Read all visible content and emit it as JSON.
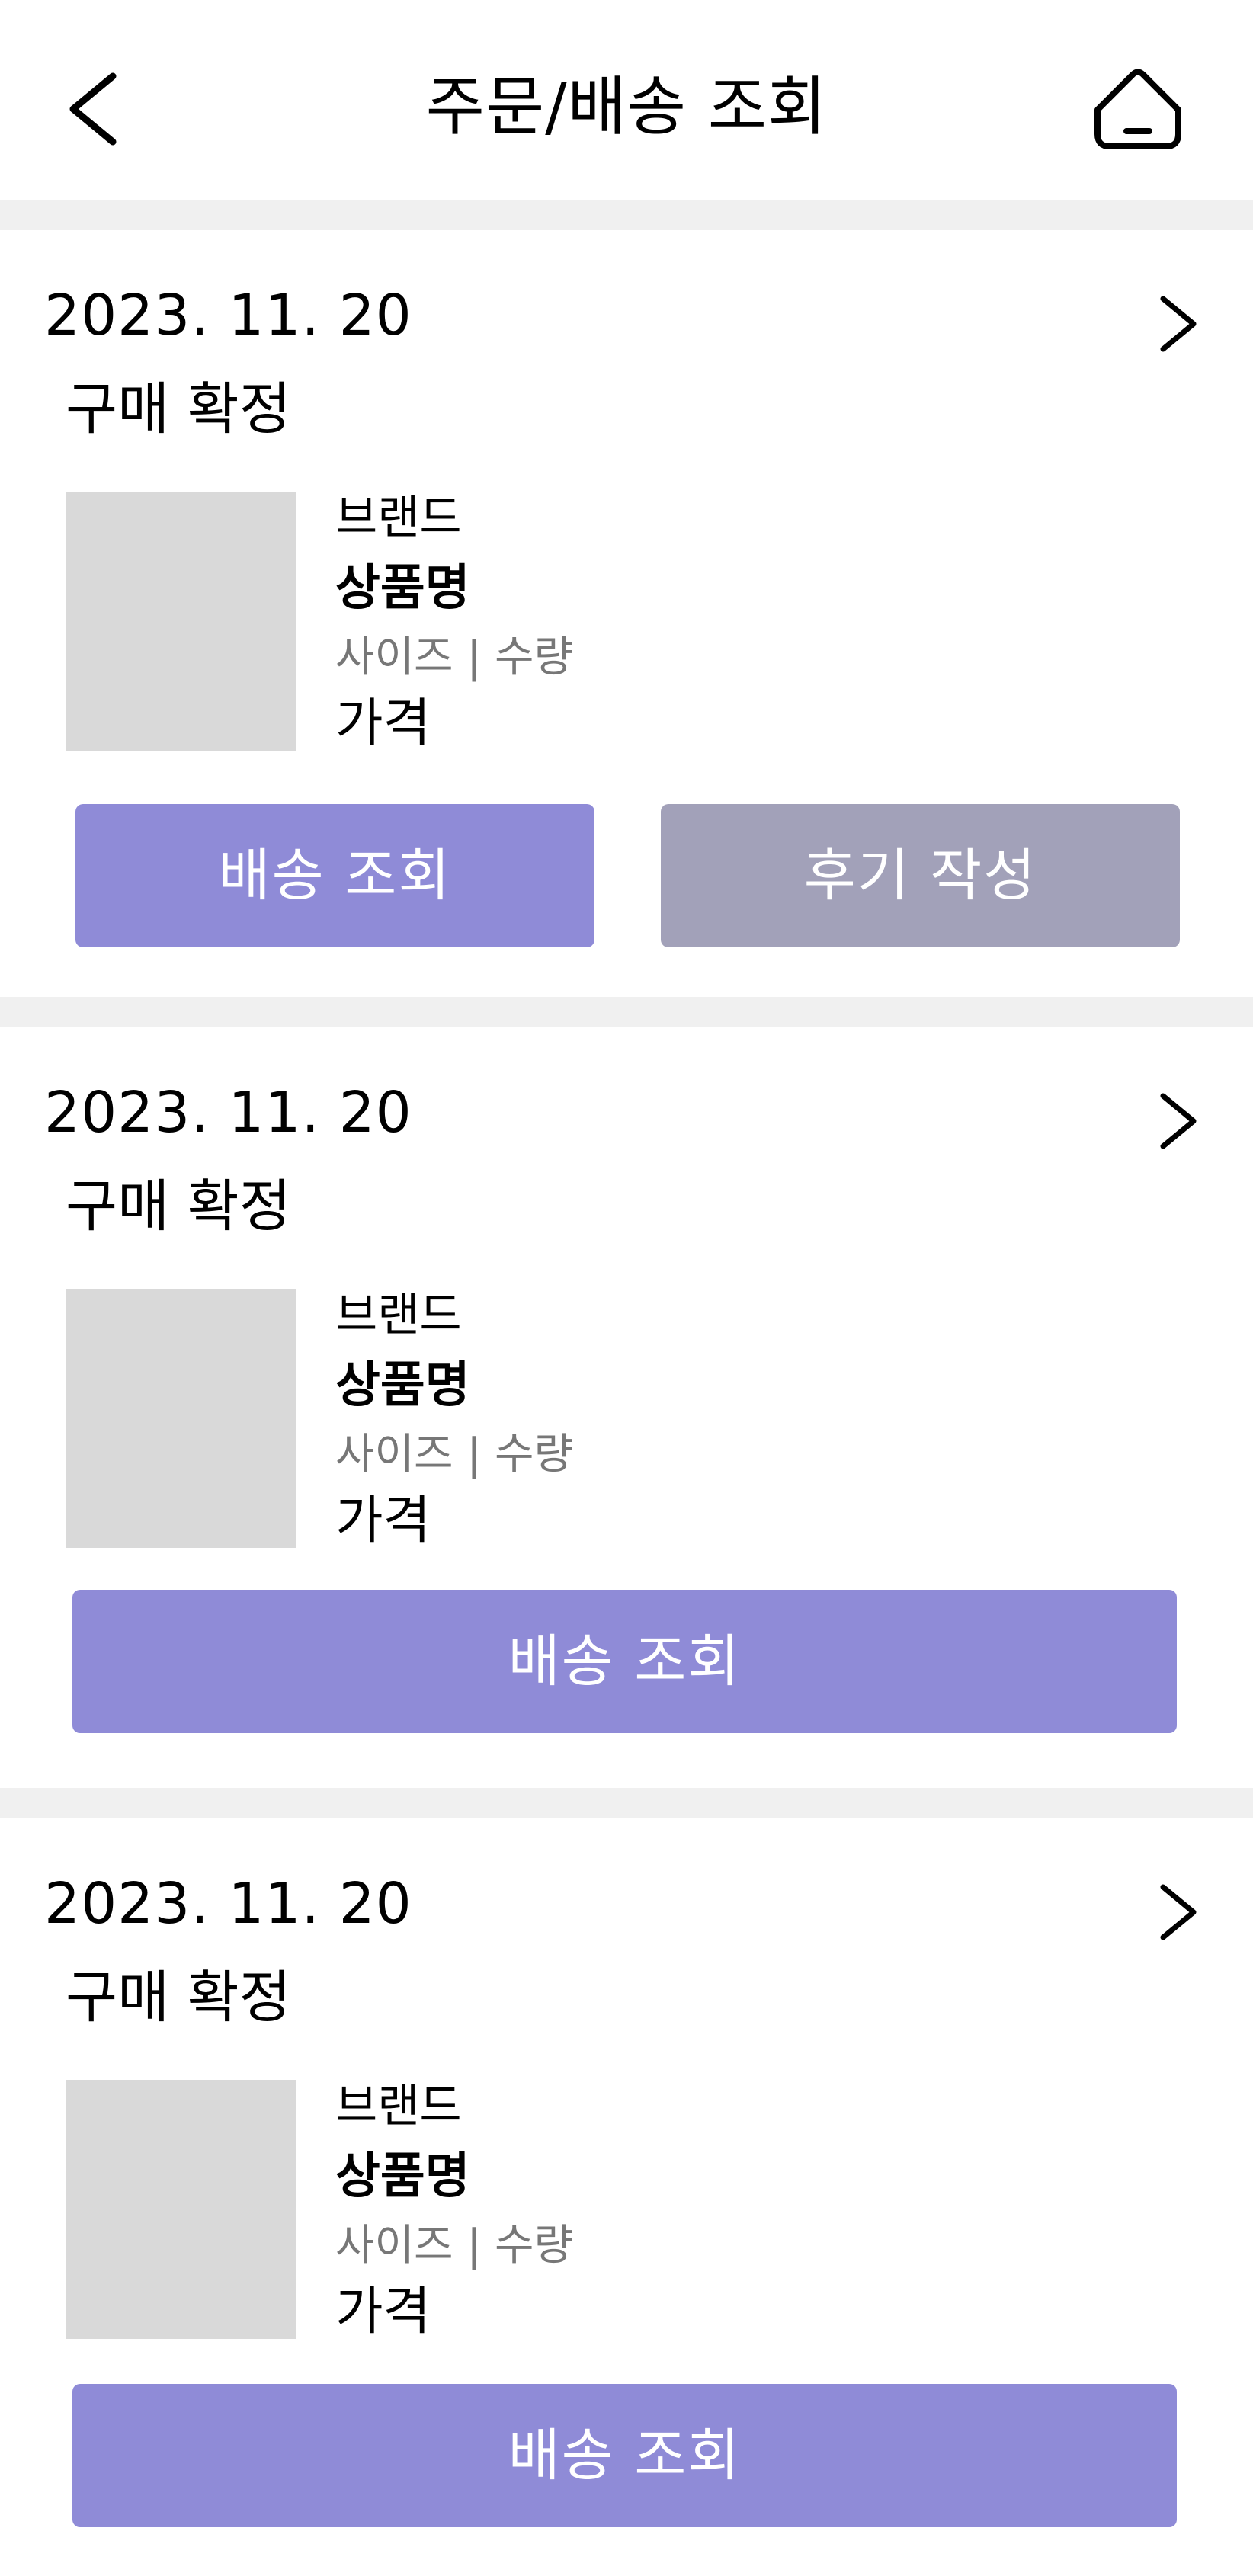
{
  "header": {
    "title": "주문/배송 조회",
    "back_icon": "chevron-left-icon",
    "home_icon": "home-icon"
  },
  "colors": {
    "track_button": "#8f8bd7",
    "review_button": "#a2a1b9",
    "divider": "#f0f0f0",
    "thumbnail": "#d9d9d9"
  },
  "orders": [
    {
      "date": "2023. 11. 20",
      "status": "구매 확정",
      "product": {
        "brand": "브랜드",
        "name": "상품명",
        "options": "사이즈 | 수량",
        "price": "가격"
      },
      "buttons": {
        "track": "배송 조회",
        "review": "후기 작성"
      }
    },
    {
      "date": "2023. 11. 20",
      "status": "구매 확정",
      "product": {
        "brand": "브랜드",
        "name": "상품명",
        "options": "사이즈 | 수량",
        "price": "가격"
      },
      "buttons": {
        "track": "배송 조회"
      }
    },
    {
      "date": "2023. 11. 20",
      "status": "구매 확정",
      "product": {
        "brand": "브랜드",
        "name": "상품명",
        "options": "사이즈 | 수량",
        "price": "가격"
      },
      "buttons": {
        "track": "배송 조회"
      }
    }
  ]
}
